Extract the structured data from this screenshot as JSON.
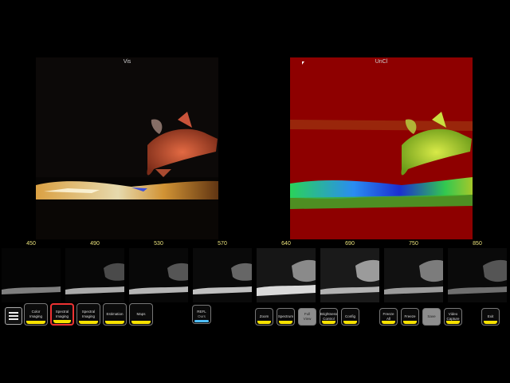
{
  "panels": {
    "left_title": "Vis",
    "right_title": "UnCl"
  },
  "bands": [
    "450",
    "490",
    "530",
    "570",
    "640",
    "690",
    "750",
    "850"
  ],
  "buttons": {
    "color_imaging": "Color Imaging",
    "spectral_imaging_1": "Spectral Imaging",
    "spectral_imaging_2": "Spectral Imaging",
    "estimation": "Estimation",
    "maps": "Maps",
    "refl": "REFL",
    "refl_sub": "Ours",
    "zoom": "Zoom",
    "spectrum": "Spectrum",
    "full_view": "Full View",
    "brightness_control": "Brightness Control",
    "config": "Config",
    "freeze_all": "Freeze All",
    "freeze": "Freeze",
    "save": "Save",
    "video_capture": "Video Capture",
    "exit": "Exit"
  },
  "colors": {
    "accent_yellow": "#f7e100",
    "selected_red": "#e33333",
    "band_label": "#e8e07a"
  }
}
